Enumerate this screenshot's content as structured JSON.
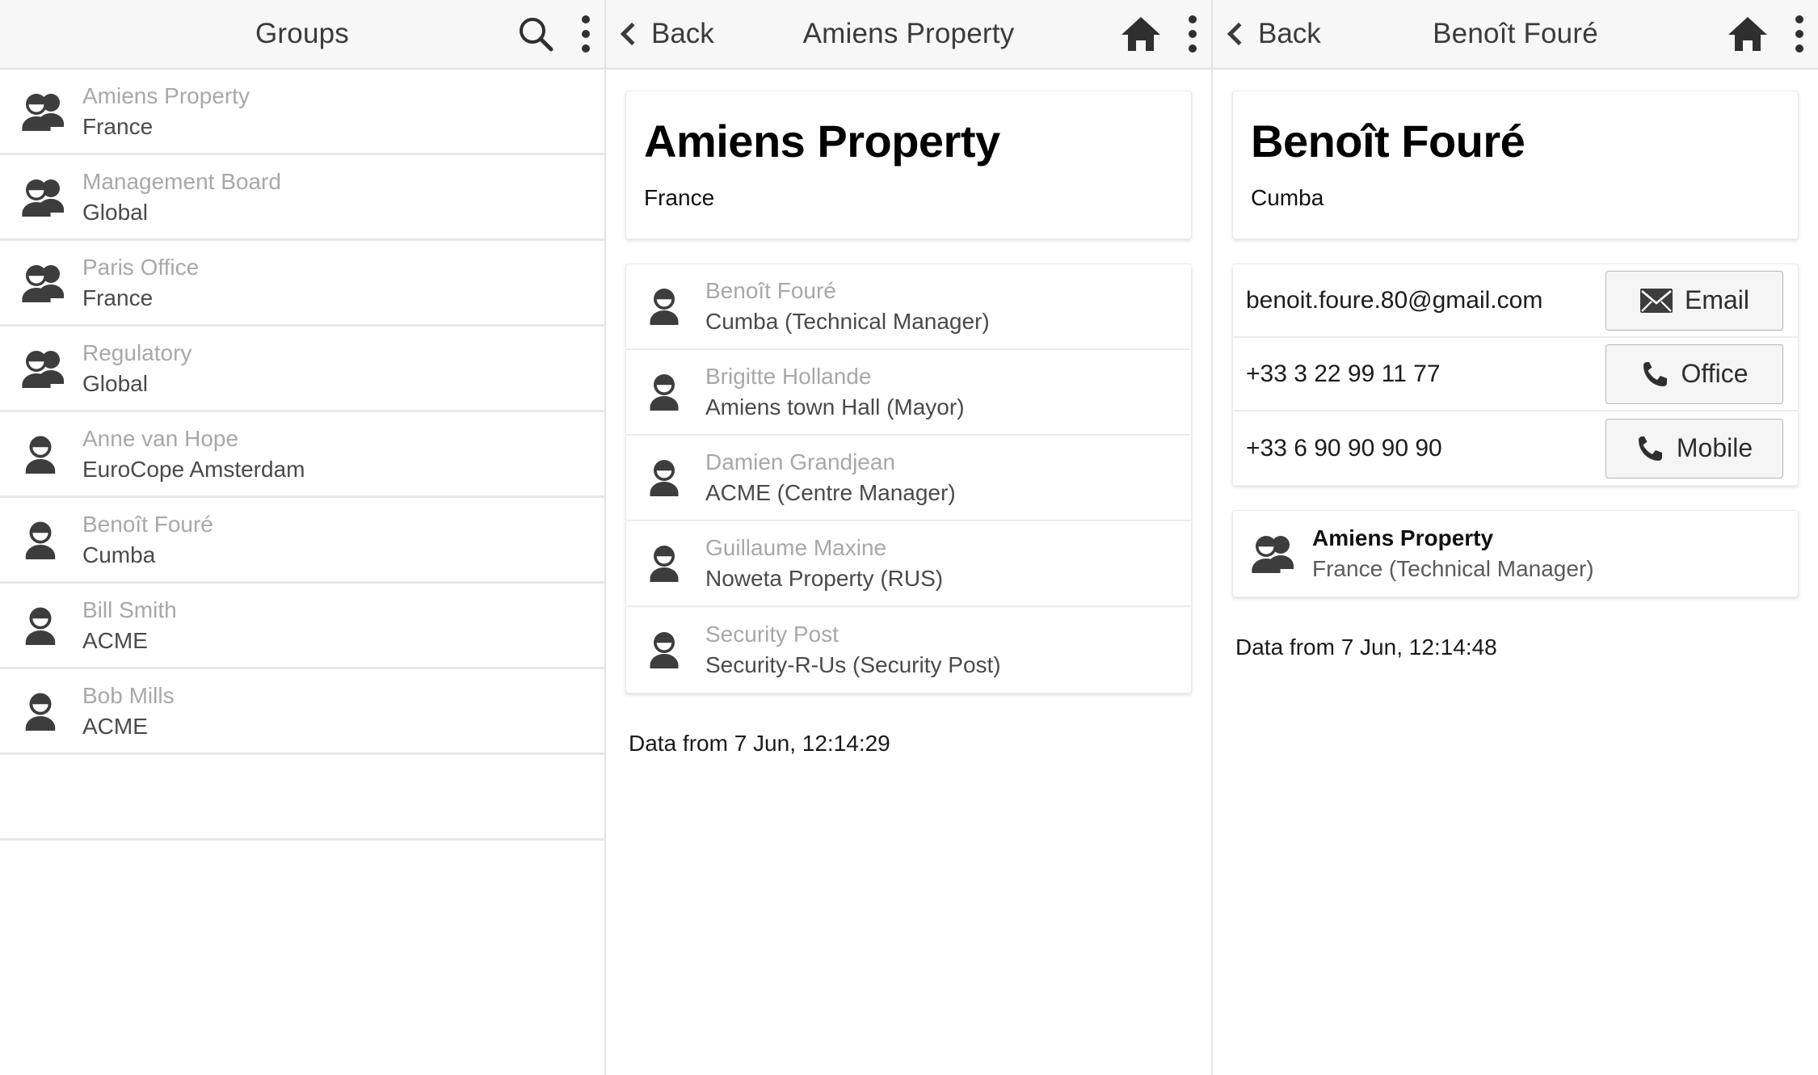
{
  "left_panel": {
    "header": {
      "title": "Groups",
      "search_icon": "search-icon",
      "menu_icon": "kebab-menu-icon"
    },
    "items": [
      {
        "type": "group",
        "title": "Amiens Property",
        "subtitle": "France"
      },
      {
        "type": "group",
        "title": "Management Board",
        "subtitle": "Global"
      },
      {
        "type": "group",
        "title": "Paris Office",
        "subtitle": "France"
      },
      {
        "type": "group",
        "title": "Regulatory",
        "subtitle": "Global"
      },
      {
        "type": "person",
        "title": "Anne van Hope",
        "subtitle": "EuroCope Amsterdam"
      },
      {
        "type": "person",
        "title": "Benoît Fouré",
        "subtitle": "Cumba"
      },
      {
        "type": "person",
        "title": "Bill Smith",
        "subtitle": "ACME"
      },
      {
        "type": "person",
        "title": "Bob Mills",
        "subtitle": "ACME"
      }
    ]
  },
  "middle_panel": {
    "header": {
      "back_label": "Back",
      "title": "Amiens Property",
      "home_icon": "home-icon",
      "menu_icon": "kebab-menu-icon"
    },
    "detail_card": {
      "title": "Amiens Property",
      "subtitle": "France"
    },
    "members": [
      {
        "title": "Benoît Fouré",
        "subtitle": "Cumba (Technical Manager)"
      },
      {
        "title": "Brigitte Hollande",
        "subtitle": "Amiens town Hall (Mayor)"
      },
      {
        "title": "Damien Grandjean",
        "subtitle": "ACME (Centre Manager)"
      },
      {
        "title": "Guillaume Maxine",
        "subtitle": "Noweta Property (RUS)"
      },
      {
        "title": "Security Post",
        "subtitle": "Security-R-Us (Security Post)"
      }
    ],
    "footnote": "Data from 7 Jun, 12:14:29"
  },
  "right_panel": {
    "header": {
      "back_label": "Back",
      "title": "Benoît Fouré",
      "home_icon": "home-icon",
      "menu_icon": "kebab-menu-icon"
    },
    "detail_card": {
      "title": "Benoît Fouré",
      "subtitle": "Cumba"
    },
    "contacts": [
      {
        "value": "benoit.foure.80@gmail.com",
        "action_label": "Email",
        "icon": "envelope-icon"
      },
      {
        "value": "+33 3 22 99 11 77",
        "action_label": "Office",
        "icon": "phone-icon"
      },
      {
        "value": "+33 6 90 90 90 90",
        "action_label": "Mobile",
        "icon": "phone-icon"
      }
    ],
    "group_membership": {
      "title": "Amiens Property",
      "subtitle": "France (Technical Manager)"
    },
    "footnote": "Data from 7 Jun, 12:14:48"
  },
  "colors": {
    "topbar_bg": "#f7f7f7",
    "divider": "#e7e7e7",
    "title_muted": "#a8a8a8",
    "text_dark": "#4a4a4a",
    "icon_dark": "#3b3b3b",
    "button_bg": "#f5f5f5",
    "button_border": "#b6b6b6"
  }
}
